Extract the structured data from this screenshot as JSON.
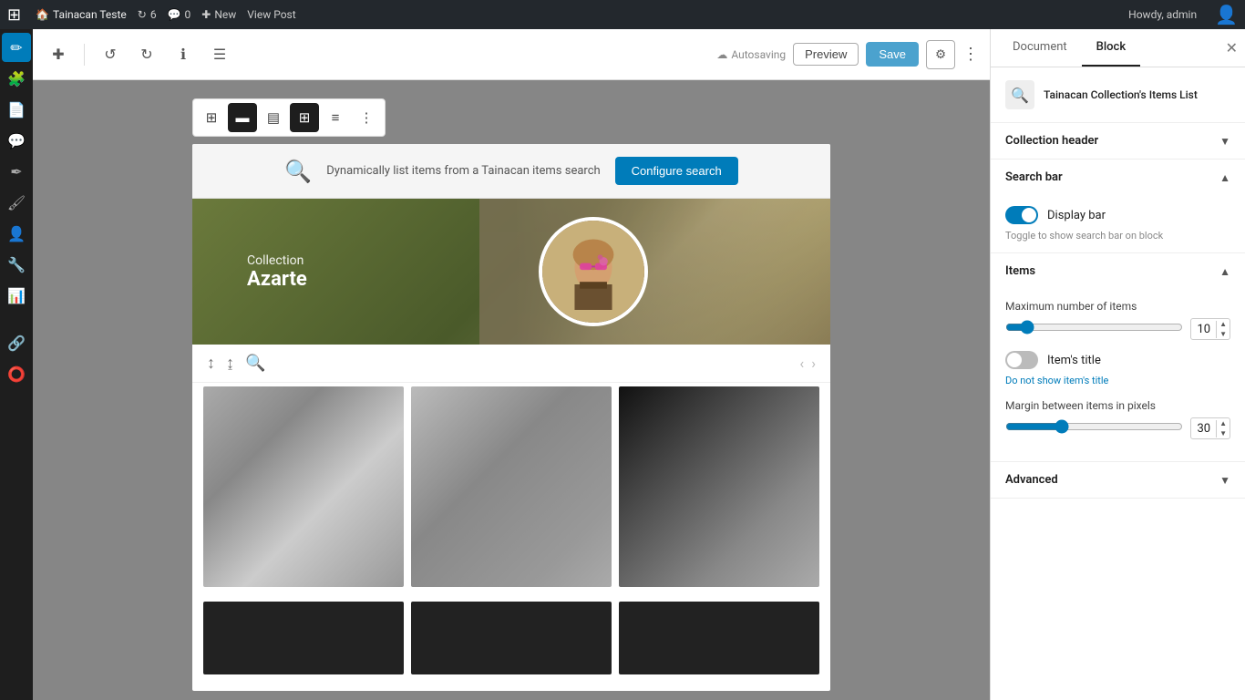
{
  "adminbar": {
    "site_name": "Tainacan Teste",
    "updates_count": "6",
    "comments_count": "0",
    "new_label": "New",
    "view_post_label": "View Post",
    "howdy": "Howdy, admin"
  },
  "editor_toolbar": {
    "autosave_label": "Autosaving",
    "preview_label": "Preview",
    "save_label": "Save"
  },
  "block_toolbar": {
    "tools": [
      "⊞",
      "▬",
      "▣",
      "⊟"
    ]
  },
  "configure_search_banner": {
    "text": "Dynamically list items from a Tainacan items search",
    "button_label": "Configure search"
  },
  "collection": {
    "label": "Collection",
    "name": "Azarte"
  },
  "items_section": {
    "max_items_label": "Maximum number of items",
    "max_items_value": "10",
    "margin_label": "Margin between items in pixels",
    "margin_value": "30"
  },
  "right_panel": {
    "tabs": {
      "document_label": "Document",
      "block_label": "Block"
    },
    "block_title": "Tainacan Collection's Items List",
    "collection_header_label": "Collection header",
    "search_bar_label": "Search bar",
    "display_bar_label": "Display bar",
    "display_bar_hint": "Toggle to show search bar on block",
    "items_label": "Items",
    "items_title_label": "Item's title",
    "items_title_hint": "Do not show item's title",
    "advanced_label": "Advanced"
  }
}
